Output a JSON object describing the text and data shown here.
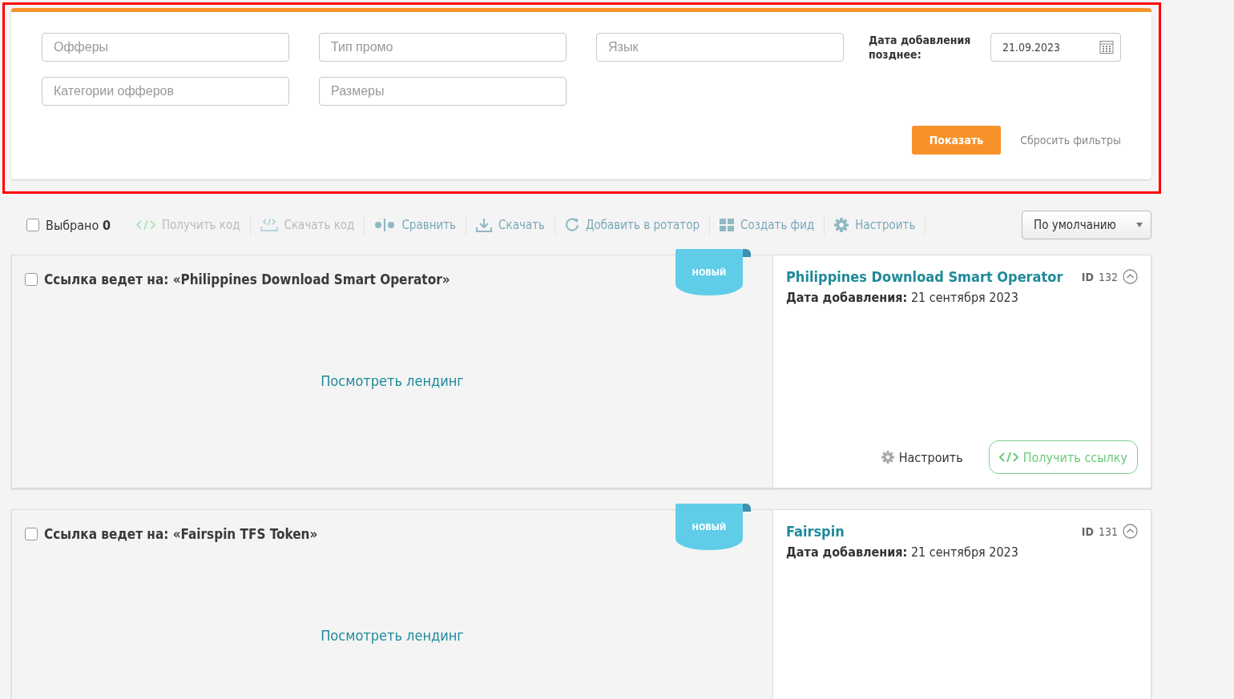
{
  "filters": {
    "fields": [
      {
        "placeholder": "Офферы"
      },
      {
        "placeholder": "Тип промо"
      },
      {
        "placeholder": "Язык"
      },
      {
        "placeholder": "Категории офферов"
      },
      {
        "placeholder": "Размеры"
      }
    ],
    "date_filter": {
      "label": "Дата добавления позднее:",
      "value": "21.09.2023"
    },
    "show_button": "Показать",
    "reset_link": "Сбросить фильтры"
  },
  "toolbar": {
    "select_all": {
      "label": "Выбрано",
      "count": "0",
      "checked": false
    },
    "actions": [
      {
        "label": "Получить код",
        "kind": "code",
        "disabled": true
      },
      {
        "label": "Скачать код",
        "kind": "download-code",
        "disabled": true
      },
      {
        "label": "Сравнить",
        "kind": "compare",
        "disabled": false
      },
      {
        "label": "Скачать",
        "kind": "download",
        "disabled": false
      },
      {
        "label": "Добавить в ротатор",
        "kind": "refresh",
        "disabled": false
      },
      {
        "label": "Создать фид",
        "kind": "grid",
        "disabled": false
      },
      {
        "label": "Настроить",
        "kind": "gear",
        "disabled": false
      }
    ],
    "sort": {
      "value": "По умолчанию"
    }
  },
  "cards": [
    {
      "checked": false,
      "title": "Ссылка ведет на: «Philippines Download Smart Operator»",
      "badge": "НОВЫЙ",
      "preview_link": "Посмотреть лендинг",
      "name": "Philippines Download Smart Operator",
      "id_label": "ID",
      "id": "132",
      "date_label": "Дата добавления:",
      "date": "21 сентября 2023",
      "settings": "Настроить",
      "get_link": "Получить ссылку"
    },
    {
      "checked": false,
      "title": "Ссылка ведет на: «Fairspin TFS Token»",
      "badge": "НОВЫЙ",
      "preview_link": "Посмотреть лендинг",
      "name": "Fairspin",
      "id_label": "ID",
      "id": "131",
      "date_label": "Дата добавления:",
      "date": "21 сентября 2023"
    }
  ]
}
